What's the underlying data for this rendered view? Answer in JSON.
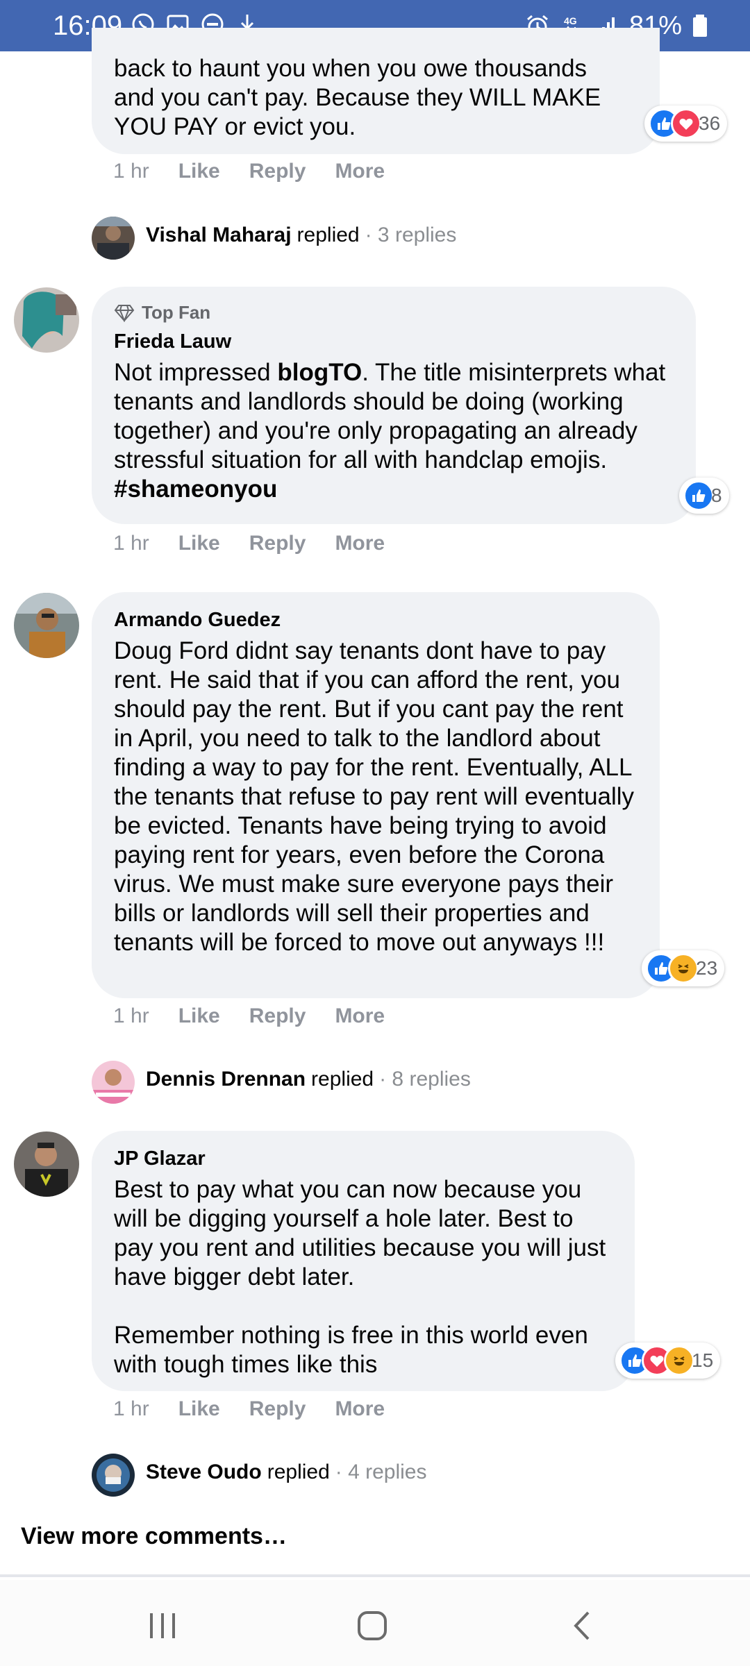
{
  "status_bar": {
    "time": "16:09",
    "battery": "81%",
    "network": "4G",
    "icons": [
      "whatsapp-icon",
      "gallery-icon",
      "dnd-icon",
      "download-icon",
      "alarm-icon",
      "signal-icon",
      "battery-icon"
    ]
  },
  "comment0": {
    "text": "back to haunt you when you owe thousands\nand you can't pay. Because they WILL MAKE\nYOU PAY or evict you.",
    "time": "1 hr",
    "reaction_count": "36",
    "replied": {
      "name": "Vishal Maharaj",
      "verb": "replied",
      "count": "· 3 replies"
    }
  },
  "comment1": {
    "badge": "Top Fan",
    "author": "Frieda Lauw",
    "text_before": "Not impressed ",
    "text_bold1": "blogTO",
    "text_middle": ". The title misinterprets what tenants and landlords should be doing (working together) and you're only propagating an already stressful situation for all with handclap emojis. ",
    "text_bold2": "#shameonyou",
    "time": "1 hr",
    "reaction_count": "8"
  },
  "comment2": {
    "author": "Armando Guedez",
    "text": "Doug Ford didnt say tenants dont have to pay rent. He said that if you can afford the rent, you should pay the rent. But if you cant pay the rent in April, you need to talk to the landlord about finding a way to pay for the rent. Eventually, ALL the tenants that refuse to pay rent will eventually be evicted. Tenants have being trying to avoid paying rent for years, even before the Corona virus. We must make sure everyone pays their bills or landlords will sell their properties and tenants will be forced to move out anyways !!!",
    "time": "1 hr",
    "reaction_count": "23",
    "replied": {
      "name": "Dennis Drennan",
      "verb": "replied",
      "count": "· 8 replies"
    }
  },
  "comment3": {
    "author": "JP Glazar",
    "text": "Best to pay what you can now because you will be digging yourself a hole later. Best to pay you rent and utilities because you will just have bigger debt later.\n\nRemember nothing is free in this world even with tough times like this",
    "time": "1 hr",
    "reaction_count": "15",
    "replied": {
      "name": "Steve Oudo",
      "verb": "replied",
      "count": "· 4 replies"
    }
  },
  "actions": {
    "like": "Like",
    "reply": "Reply",
    "more": "More"
  },
  "view_more": "View more comments…",
  "colors": {
    "status_bar": "#4267b2",
    "bubble": "#f0f2f5",
    "like": "#1877f2",
    "love": "#f33e58",
    "haha": "#f7b125",
    "muted": "#90949c"
  }
}
